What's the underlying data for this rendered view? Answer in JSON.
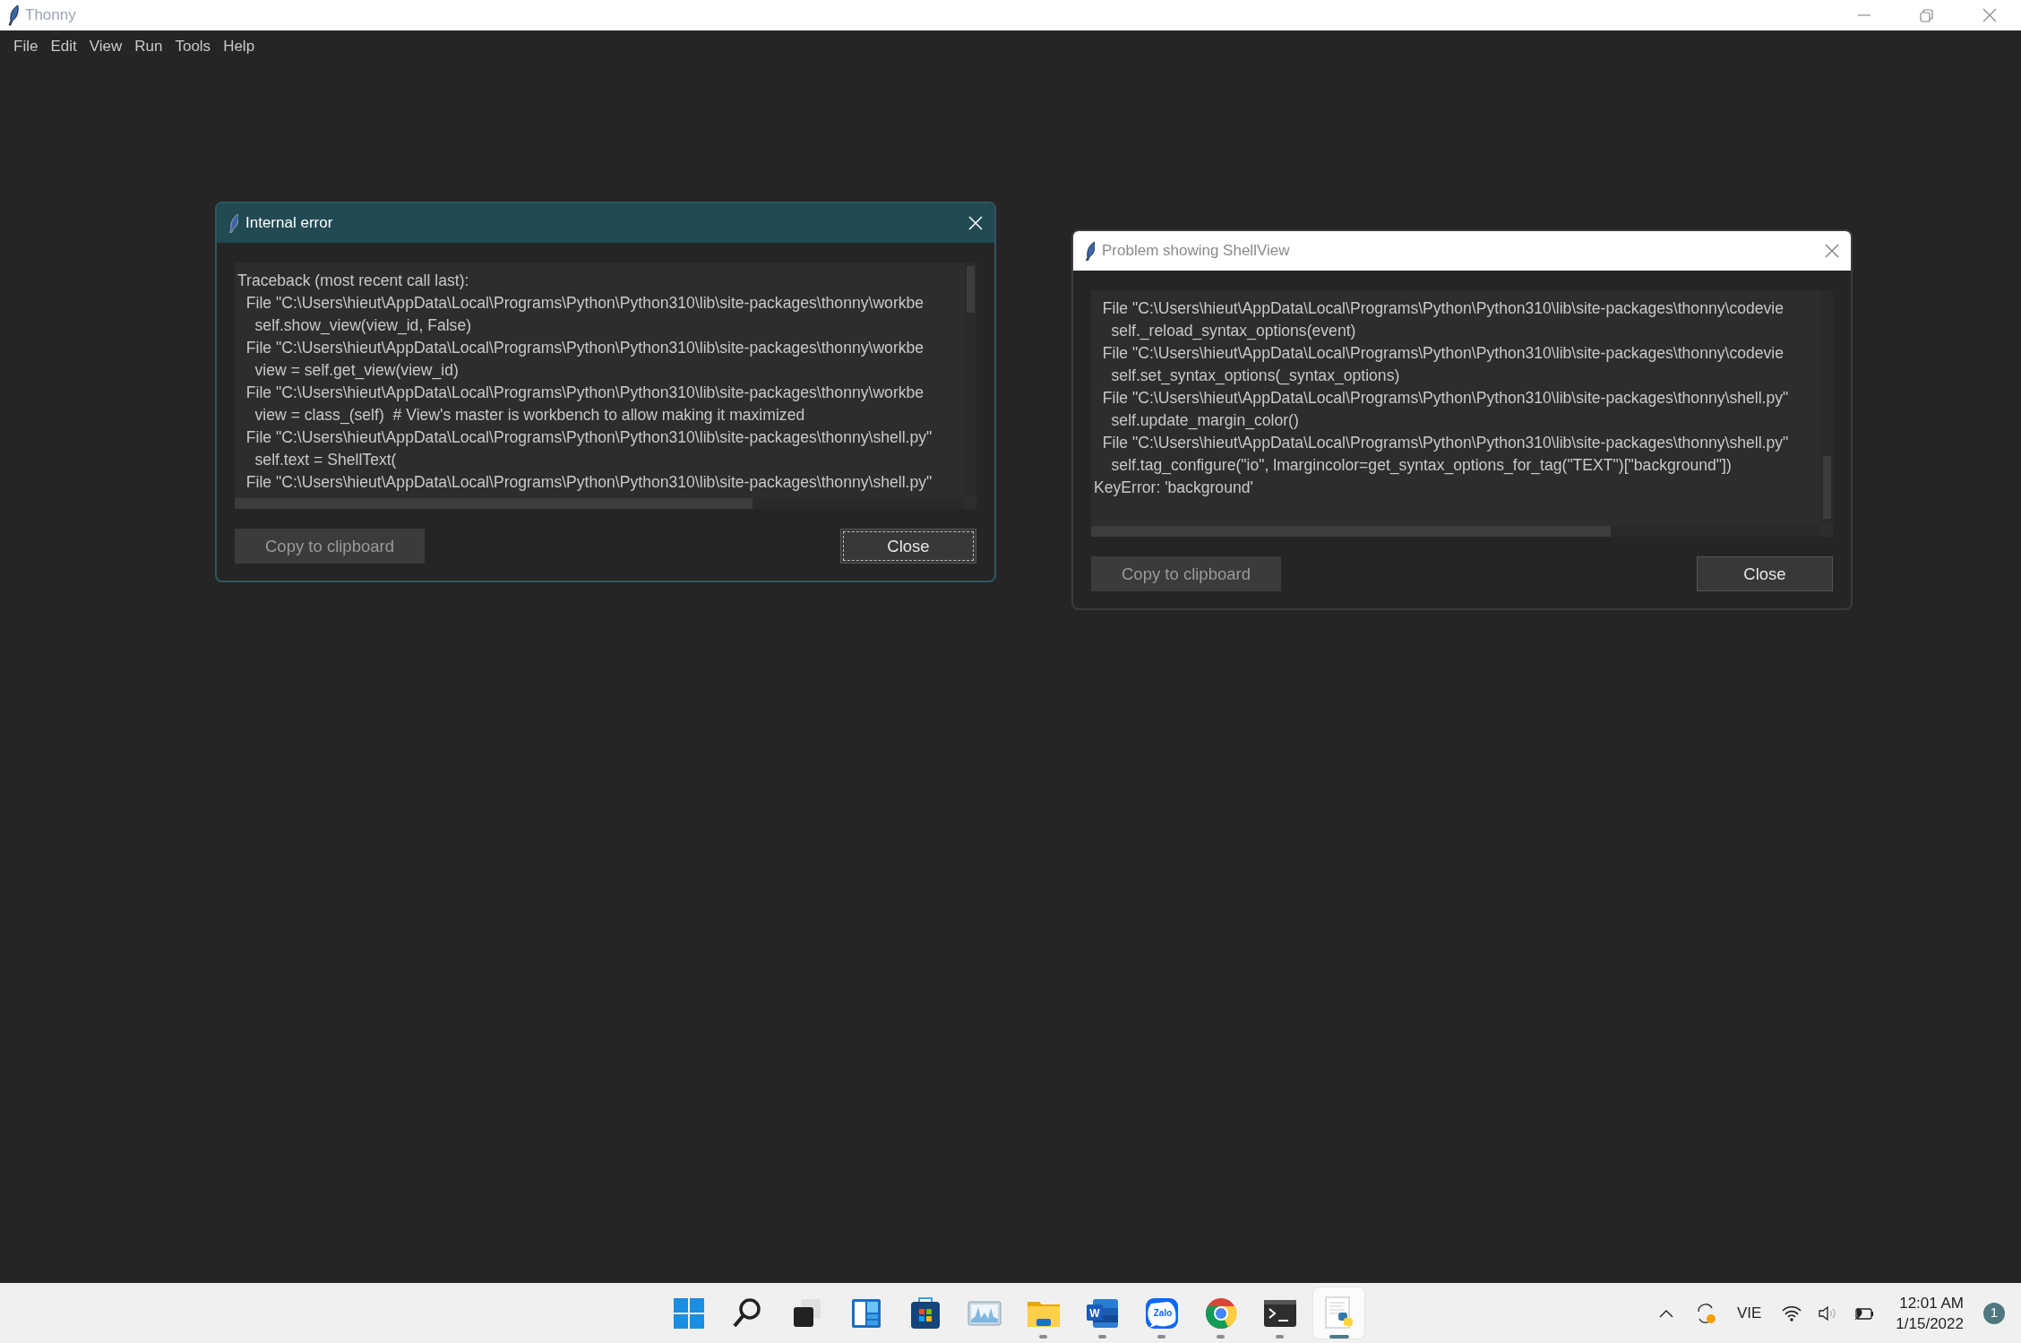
{
  "app": {
    "title": "Thonny",
    "active": false,
    "menu": [
      "File",
      "Edit",
      "View",
      "Run",
      "Tools",
      "Help"
    ]
  },
  "dialogs": [
    {
      "title": "Internal error",
      "active": true,
      "lines": [
        "Traceback (most recent call last):",
        "  File \"C:\\Users\\hieut\\AppData\\Local\\Programs\\Python\\Python310\\lib\\site-packages\\thonny\\workbe",
        "    self.show_view(view_id, False)",
        "  File \"C:\\Users\\hieut\\AppData\\Local\\Programs\\Python\\Python310\\lib\\site-packages\\thonny\\workbe",
        "    view = self.get_view(view_id)",
        "  File \"C:\\Users\\hieut\\AppData\\Local\\Programs\\Python\\Python310\\lib\\site-packages\\thonny\\workbe",
        "    view = class_(self)  # View's master is workbench to allow making it maximized",
        "  File \"C:\\Users\\hieut\\AppData\\Local\\Programs\\Python\\Python310\\lib\\site-packages\\thonny\\shell.py\"",
        "    self.text = ShellText(",
        "  File \"C:\\Users\\hieut\\AppData\\Local\\Programs\\Python\\Python310\\lib\\site-packages\\thonny\\shell.py\""
      ],
      "buttons": [
        {
          "label": "Copy to clipboard",
          "focused": false
        },
        {
          "label": "Close",
          "focused": true
        }
      ]
    },
    {
      "title": "Problem showing ShellView",
      "active": false,
      "lines": [
        "  File \"C:\\Users\\hieut\\AppData\\Local\\Programs\\Python\\Python310\\lib\\site-packages\\thonny\\codevie",
        "    self._reload_syntax_options(event)",
        "  File \"C:\\Users\\hieut\\AppData\\Local\\Programs\\Python\\Python310\\lib\\site-packages\\thonny\\codevie",
        "    self.set_syntax_options(_syntax_options)",
        "  File \"C:\\Users\\hieut\\AppData\\Local\\Programs\\Python\\Python310\\lib\\site-packages\\thonny\\shell.py\"",
        "    self.update_margin_color()",
        "  File \"C:\\Users\\hieut\\AppData\\Local\\Programs\\Python\\Python310\\lib\\site-packages\\thonny\\shell.py\"",
        "    self.tag_configure(\"io\", lmargincolor=get_syntax_options_for_tag(\"TEXT\")[\"background\"])",
        "KeyError: 'background'"
      ],
      "buttons": [
        {
          "label": "Copy to clipboard",
          "focused": false
        },
        {
          "label": "Close",
          "focused": false
        }
      ]
    }
  ],
  "taskbar": {
    "apps": [
      {
        "kind": "start",
        "running": false,
        "selected": false
      },
      {
        "kind": "search",
        "running": false,
        "selected": false
      },
      {
        "kind": "taskview",
        "running": false,
        "selected": false
      },
      {
        "kind": "widgets",
        "running": false,
        "selected": false
      },
      {
        "kind": "store",
        "running": false,
        "selected": false
      },
      {
        "kind": "monitor",
        "running": false,
        "selected": false
      },
      {
        "kind": "folder",
        "running": true,
        "selected": false
      },
      {
        "kind": "word",
        "label": "W",
        "running": true,
        "selected": false
      },
      {
        "kind": "chat",
        "label": "Zalo",
        "running": true,
        "selected": false
      },
      {
        "kind": "browser",
        "running": true,
        "selected": false
      },
      {
        "kind": "terminal",
        "running": true,
        "selected": false
      },
      {
        "kind": "pyfile",
        "running": true,
        "selected": true
      }
    ],
    "language": "VIE",
    "time": "12:01 AM",
    "date": "1/15/2022",
    "notifications": "1"
  }
}
